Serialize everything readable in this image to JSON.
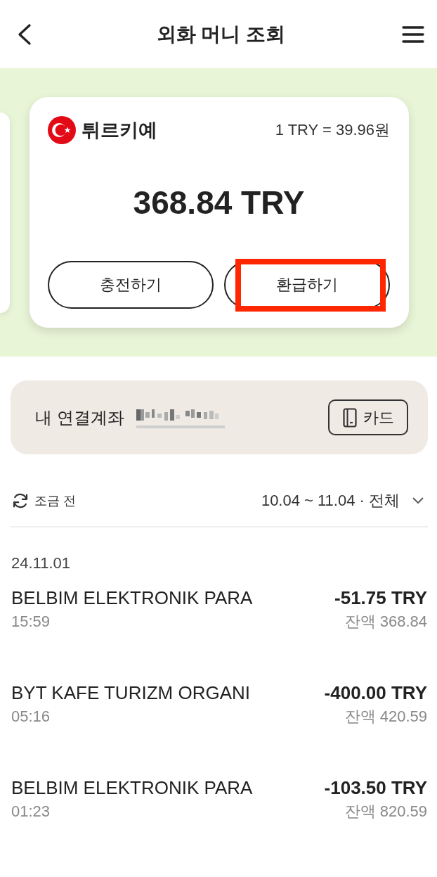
{
  "header": {
    "title": "외화 머니 조회"
  },
  "wallet_card": {
    "country": "튀르키예",
    "rate": "1 TRY = 39.96원",
    "balance": "368.84 TRY",
    "actions": [
      {
        "label": "충전하기",
        "highlighted": false
      },
      {
        "label": "환급하기",
        "highlighted": true
      }
    ]
  },
  "linked_account": {
    "label": "내 연결계좌",
    "card_button": "카드"
  },
  "filter": {
    "updated": "조금 전",
    "period": "10.04 ~ 11.04 · 전체"
  },
  "transactions": [
    {
      "date": "24.11.01",
      "items": [
        {
          "merchant": "BELBIM ELEKTRONIK PARA",
          "time": "15:59",
          "amount": "-51.75 TRY",
          "balance": "잔액 368.84"
        },
        {
          "merchant": "BYT KAFE TURIZM ORGANI",
          "time": "05:16",
          "amount": "-400.00 TRY",
          "balance": "잔액 420.59"
        },
        {
          "merchant": "BELBIM ELEKTRONIK PARA",
          "time": "01:23",
          "amount": "-103.50 TRY",
          "balance": "잔액 820.59"
        }
      ]
    }
  ]
}
